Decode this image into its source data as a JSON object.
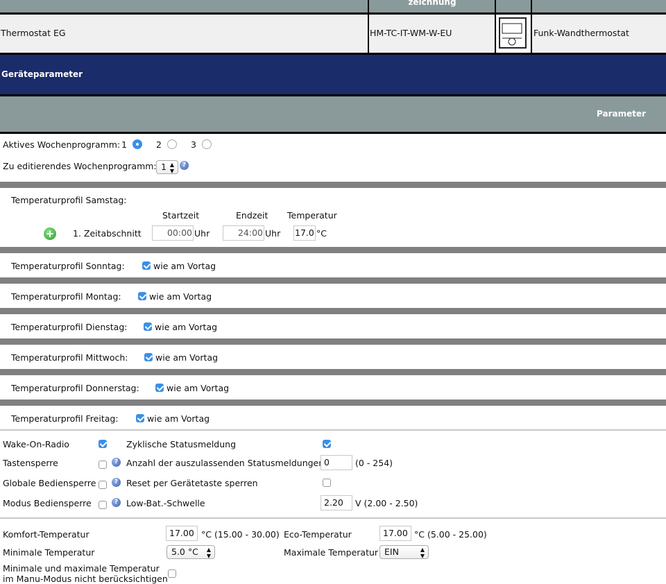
{
  "device_table": {
    "header_partial": "zeichnung",
    "row": {
      "name": "Thermostat EG",
      "type": "HM-TC-IT-WM-W-EU",
      "image_icon": "thermostat-device-icon",
      "description": "Funk-Wandthermostat"
    }
  },
  "section_title": "Geräteparameter",
  "parameter_header": "Parameter",
  "colors": {
    "header_gray": "#8a9a9b",
    "section_blue": "#1b2c6b",
    "separator": "#808080",
    "checkbox_blue": "#3b8fe8"
  },
  "week_program": {
    "active_label": "Aktives Wochenprogramm:",
    "options": [
      "1",
      "2",
      "3"
    ],
    "selected": "1",
    "edit_label": "Zu editierendes Wochenprogramm:",
    "edit_value": "1"
  },
  "saturday": {
    "label": "Temperaturprofil Samstag:",
    "col_start": "Startzeit",
    "col_end": "Endzeit",
    "col_temp": "Temperatur",
    "period_label": "1. Zeitabschnitt",
    "start": "00:00",
    "end": "24:00",
    "unit_time": "Uhr",
    "temp": "17.0",
    "unit_temp": "°C"
  },
  "days": [
    {
      "label": "Temperaturprofil Sonntag:",
      "same": "wie am Vortag",
      "checked": true
    },
    {
      "label": "Temperaturprofil Montag:",
      "same": "wie am Vortag",
      "checked": true
    },
    {
      "label": "Temperaturprofil Dienstag:",
      "same": "wie am Vortag",
      "checked": true
    },
    {
      "label": "Temperaturprofil Mittwoch:",
      "same": "wie am Vortag",
      "checked": true
    },
    {
      "label": "Temperaturprofil Donnerstag:",
      "same": "wie am Vortag",
      "checked": true
    },
    {
      "label": "Temperaturprofil Freitag:",
      "same": "wie am Vortag",
      "checked": true
    }
  ],
  "settings": {
    "wake_on_radio": "Wake-On-Radio",
    "tastensperre": "Tastensperre",
    "globale": "Globale Bediensperre",
    "modus": "Modus Bediensperre",
    "zyklisch": "Zyklische Statusmeldung",
    "anzahl": "Anzahl der auszulassenden Statusmeldungen",
    "anzahl_value": "0",
    "anzahl_range": "(0 - 254)",
    "reset": "Reset per Gerätetaste sperren",
    "lowbat": "Low-Bat.-Schwelle",
    "lowbat_value": "2.20",
    "lowbat_range": "V (2.00 - 2.50)"
  },
  "temps": {
    "komfort": "Komfort-Temperatur",
    "komfort_value": "17.00",
    "komfort_range": "°C (15.00 - 30.00)",
    "eco": "Eco-Temperatur",
    "eco_value": "17.00",
    "eco_range": "°C (5.00 - 25.00)",
    "min": "Minimale Temperatur",
    "min_value": "5.0 °C",
    "max": "Maximale Temperatur",
    "max_value": "EIN",
    "minmax_line1": "Minimale und maximale Temperatur",
    "minmax_line2": "im Manu-Modus nicht berücksichtigen"
  }
}
